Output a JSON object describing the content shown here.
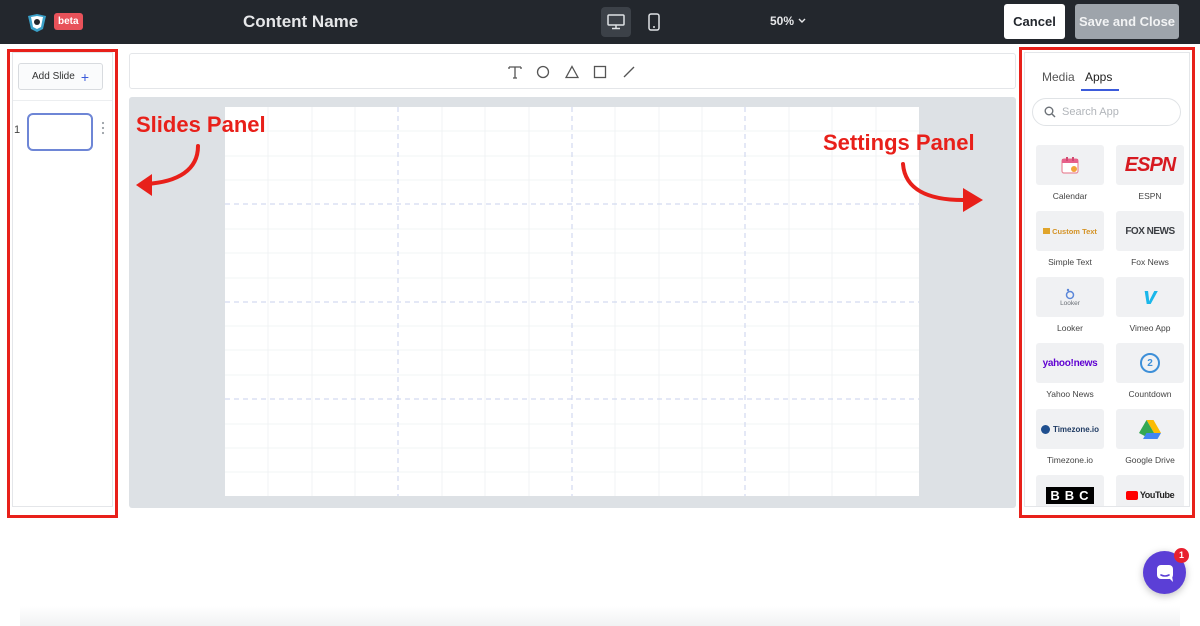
{
  "header": {
    "badge": "beta",
    "content_name": "Content Name",
    "zoom": "50%",
    "cancel_label": "Cancel",
    "save_label": "Save and Close"
  },
  "slides_panel": {
    "add_slide_label": "Add Slide",
    "slides": [
      {
        "number": "1"
      }
    ]
  },
  "toolbar": {
    "tools": [
      "text-tool-icon",
      "circle-tool-icon",
      "triangle-tool-icon",
      "square-tool-icon",
      "line-tool-icon"
    ]
  },
  "settings_panel": {
    "tabs": [
      {
        "label": "Media"
      },
      {
        "label": "Apps",
        "active": true
      }
    ],
    "search_placeholder": "Search App",
    "apps": [
      {
        "label": "Calendar",
        "icon": "calendar-icon"
      },
      {
        "label": "ESPN",
        "icon": "espn-logo",
        "logo_text": "ESPN"
      },
      {
        "label": "Simple Text",
        "icon": "custom-text-logo",
        "logo_text": "Custom Text"
      },
      {
        "label": "Fox News",
        "icon": "fox-news-logo",
        "logo_text": "FOX NEWS"
      },
      {
        "label": "Looker",
        "icon": "looker-logo",
        "logo_text": "Looker"
      },
      {
        "label": "Vimeo App",
        "icon": "vimeo-logo",
        "logo_text": "v"
      },
      {
        "label": "Yahoo News",
        "icon": "yahoo-news-logo",
        "logo_text": "yahoo!news"
      },
      {
        "label": "Countdown",
        "icon": "countdown-icon",
        "logo_text": "2"
      },
      {
        "label": "Timezone.io",
        "icon": "timezone-logo",
        "logo_text": "Timezone.io"
      },
      {
        "label": "Google Drive",
        "icon": "google-drive-logo"
      },
      {
        "label": "BBC",
        "icon": "bbc-logo",
        "logo_text": "BBC"
      },
      {
        "label": "YouTube",
        "icon": "youtube-logo",
        "logo_text": "YouTube"
      }
    ]
  },
  "annotations": {
    "slides_panel_label": "Slides Panel",
    "settings_panel_label": "Settings Panel"
  },
  "chat": {
    "badge_count": "1"
  },
  "colors": {
    "topbar": "#23272d",
    "accent": "#3b5bdb",
    "annotation": "#e8201a",
    "chat": "#5b3fd6"
  }
}
